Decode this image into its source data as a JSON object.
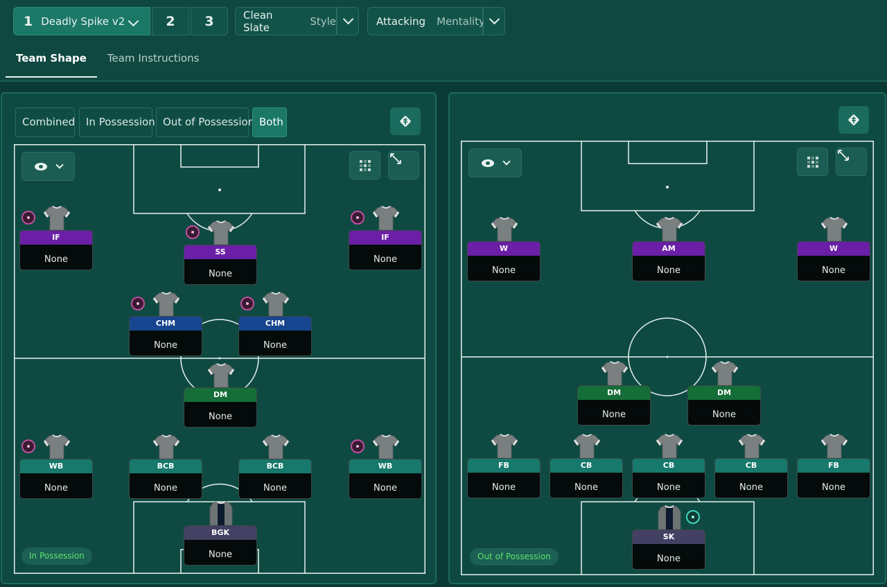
{
  "header": {
    "tactic_slots": [
      {
        "number": "1",
        "name": "Deadly Spike v2"
      },
      {
        "number": "2"
      },
      {
        "number": "3"
      }
    ],
    "style": {
      "value": "Clean Slate",
      "label": "Style"
    },
    "mentality": {
      "value": "Attacking",
      "label": "Mentality"
    },
    "tabs": [
      {
        "label": "Team Shape",
        "active": true
      },
      {
        "label": "Team Instructions",
        "active": false
      }
    ]
  },
  "left_panel": {
    "segments": [
      {
        "label": "Combined",
        "active": false
      },
      {
        "label": "In Possession",
        "active": false
      },
      {
        "label": "Out of Possession",
        "active": false
      },
      {
        "label": "Both",
        "active": true
      }
    ],
    "state_label": "In Possession",
    "players": [
      {
        "role": "IF",
        "name": "None",
        "color": "#6a1fa6"
      },
      {
        "role": "SS",
        "name": "None",
        "color": "#6a1fa6"
      },
      {
        "role": "IF",
        "name": "None",
        "color": "#6a1fa6"
      },
      {
        "role": "CHM",
        "name": "None",
        "color": "#18458f"
      },
      {
        "role": "CHM",
        "name": "None",
        "color": "#18458f"
      },
      {
        "role": "DM",
        "name": "None",
        "color": "#156e38"
      },
      {
        "role": "WB",
        "name": "None",
        "color": "#17786c"
      },
      {
        "role": "BCB",
        "name": "None",
        "color": "#17786c"
      },
      {
        "role": "BCB",
        "name": "None",
        "color": "#17786c"
      },
      {
        "role": "WB",
        "name": "None",
        "color": "#17786c"
      },
      {
        "role": "BGK",
        "name": "None",
        "color": "#434064"
      }
    ]
  },
  "right_panel": {
    "state_label": "Out of Possession",
    "players": [
      {
        "role": "W",
        "name": "None",
        "color": "#6a1fa6"
      },
      {
        "role": "AM",
        "name": "None",
        "color": "#6a1fa6"
      },
      {
        "role": "W",
        "name": "None",
        "color": "#6a1fa6"
      },
      {
        "role": "DM",
        "name": "None",
        "color": "#156e38"
      },
      {
        "role": "DM",
        "name": "None",
        "color": "#156e38"
      },
      {
        "role": "FB",
        "name": "None",
        "color": "#17786c"
      },
      {
        "role": "CB",
        "name": "None",
        "color": "#17786c"
      },
      {
        "role": "CB",
        "name": "None",
        "color": "#17786c"
      },
      {
        "role": "CB",
        "name": "None",
        "color": "#17786c"
      },
      {
        "role": "FB",
        "name": "None",
        "color": "#17786c"
      },
      {
        "role": "SK",
        "name": "None",
        "color": "#434064"
      }
    ]
  },
  "icons": {
    "visibility": "eye-icon",
    "dropdown": "chevron-down-icon",
    "tactics_board": "tactics-board-icon",
    "grid": "grid-icon",
    "expand": "expand-icon",
    "player_kit": "shirt-icon",
    "player_trait": "trait-icon"
  },
  "colors": {
    "background": "#0b3a35",
    "accent": "#1b7867",
    "state_text": "#5ee36e"
  }
}
